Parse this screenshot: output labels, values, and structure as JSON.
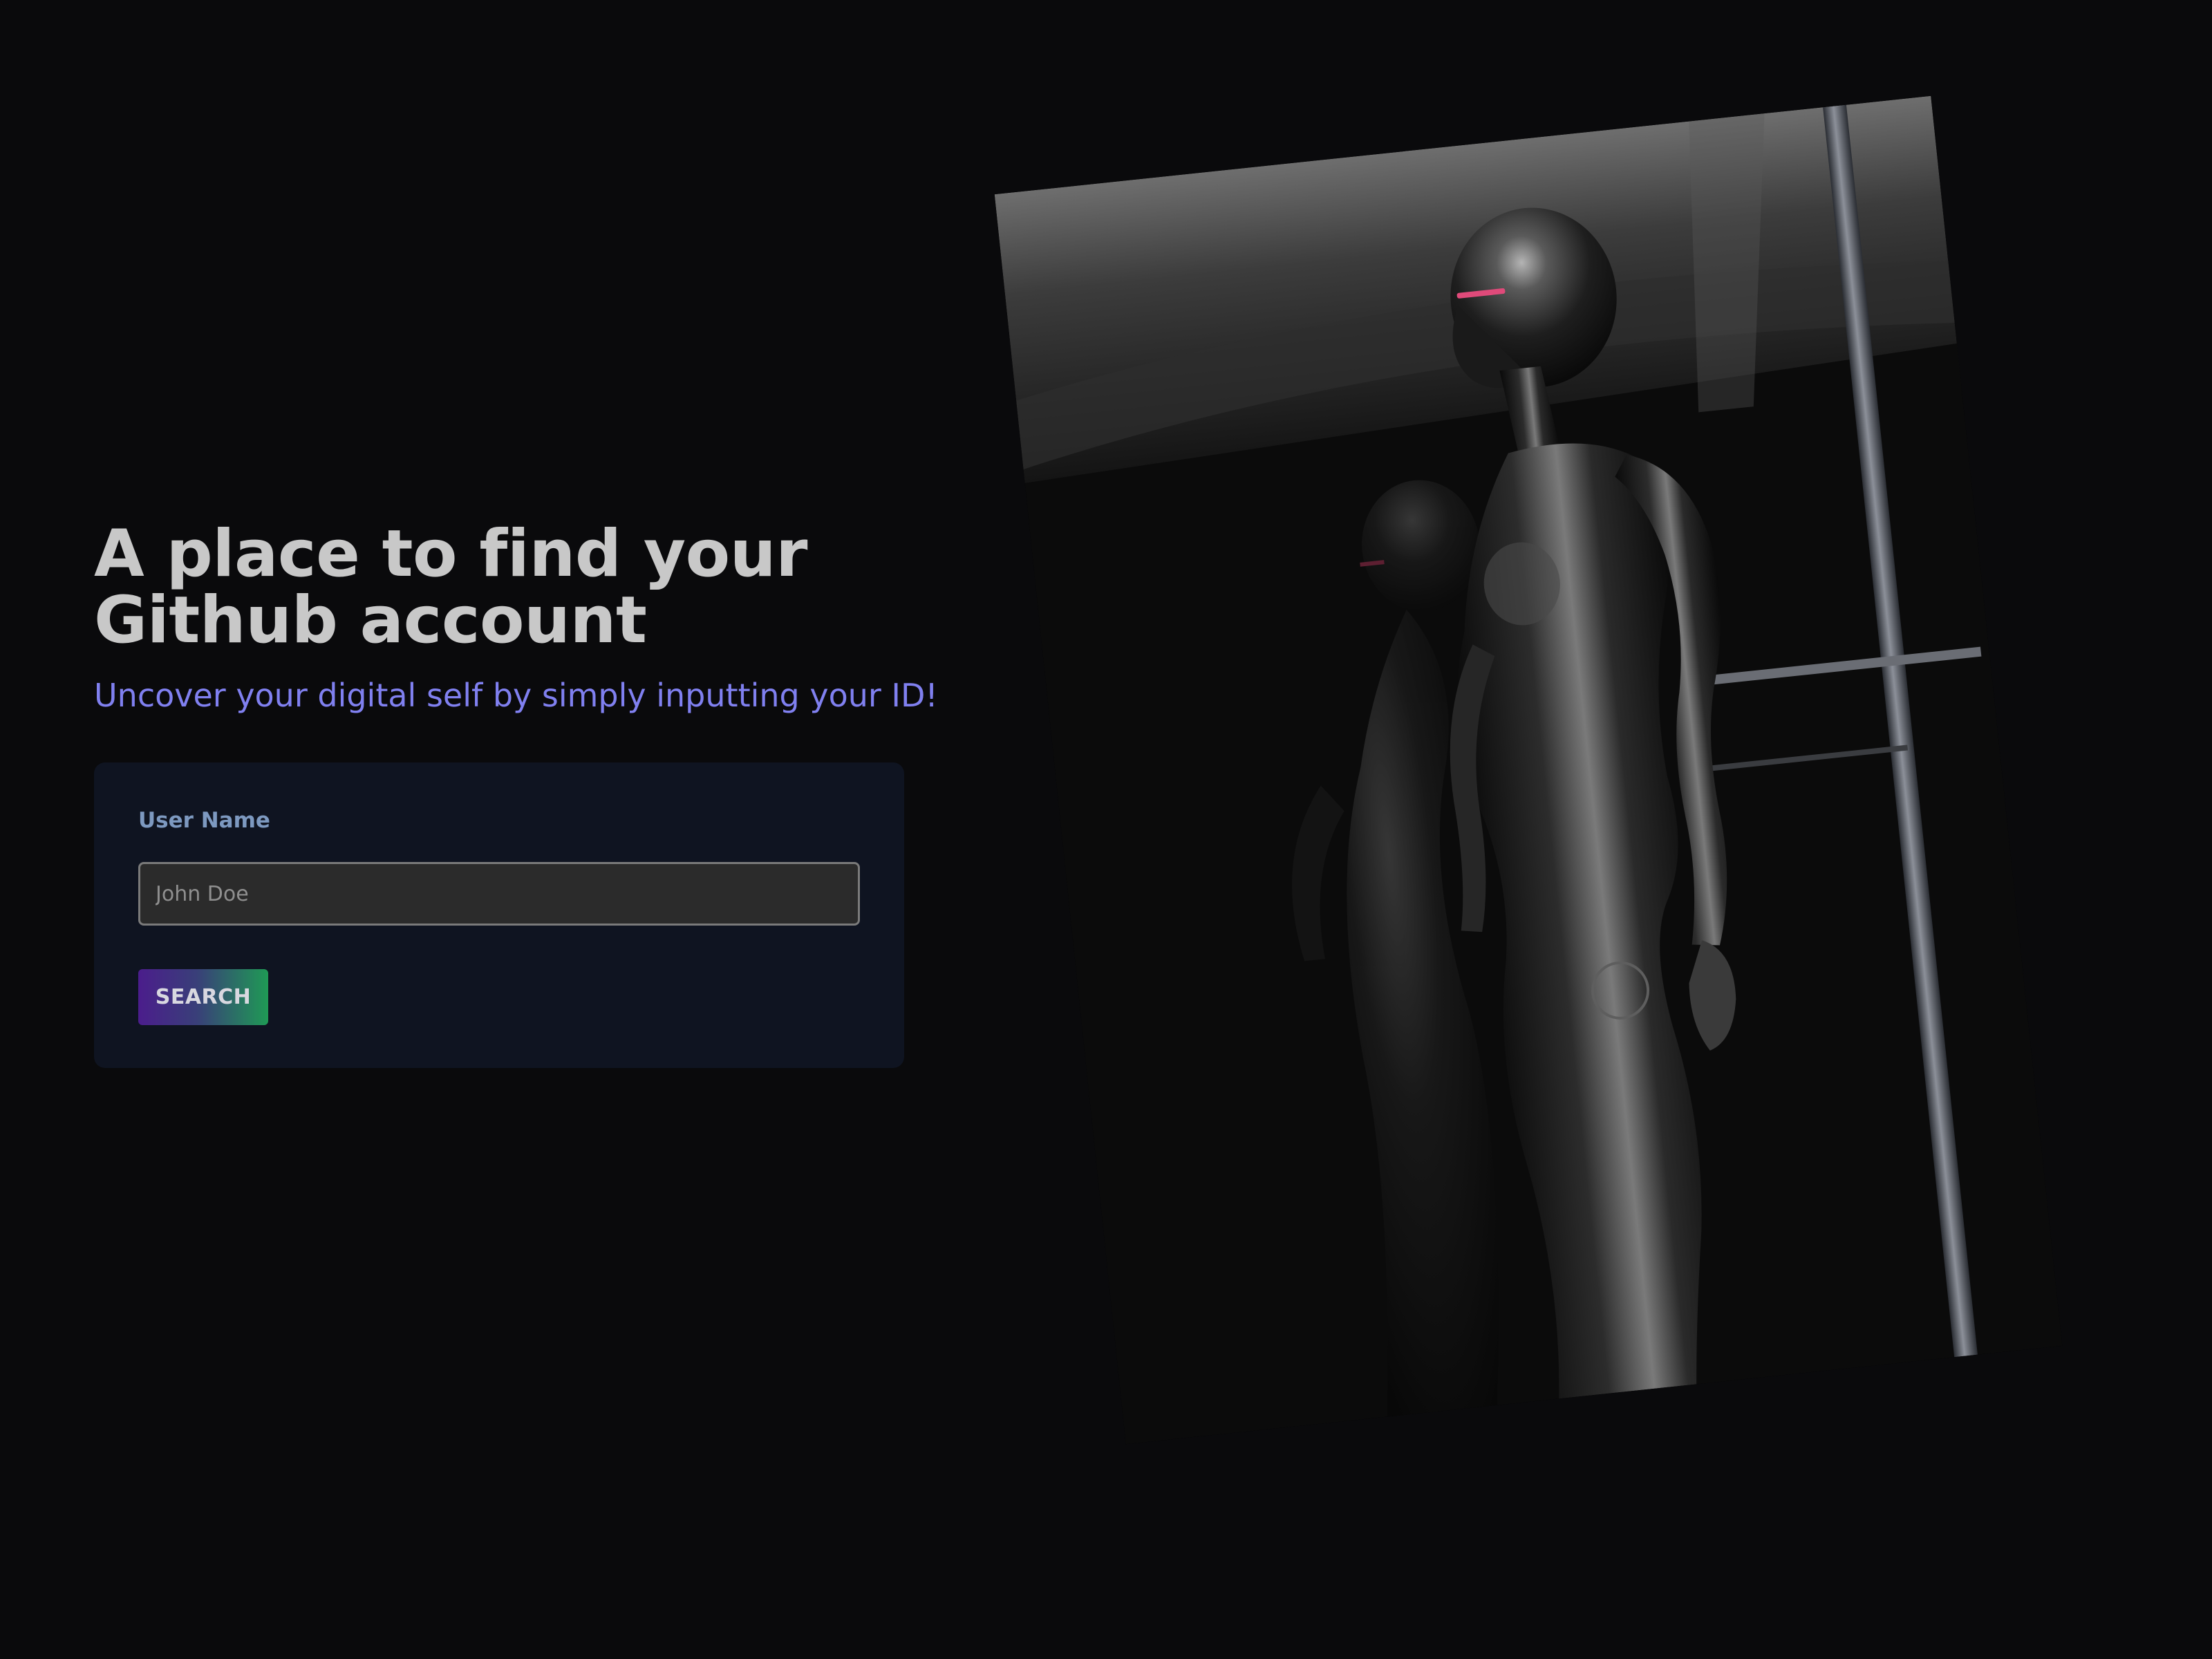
{
  "hero": {
    "title_line1": "A place to find your",
    "title_line2": "Github account",
    "subtitle": "Uncover your digital self by simply inputting your ID!"
  },
  "search_form": {
    "label": "User Name",
    "placeholder": "John Doe",
    "value": "",
    "button_label": "SEARCH"
  },
  "colors": {
    "background": "#0a0a0c",
    "title": "#c8c8c8",
    "subtitle": "#8080f0",
    "card": "#0f1421",
    "label": "#7d99c0",
    "button_gradient_start": "#4b1d8c",
    "button_gradient_end": "#1f9a55"
  }
}
